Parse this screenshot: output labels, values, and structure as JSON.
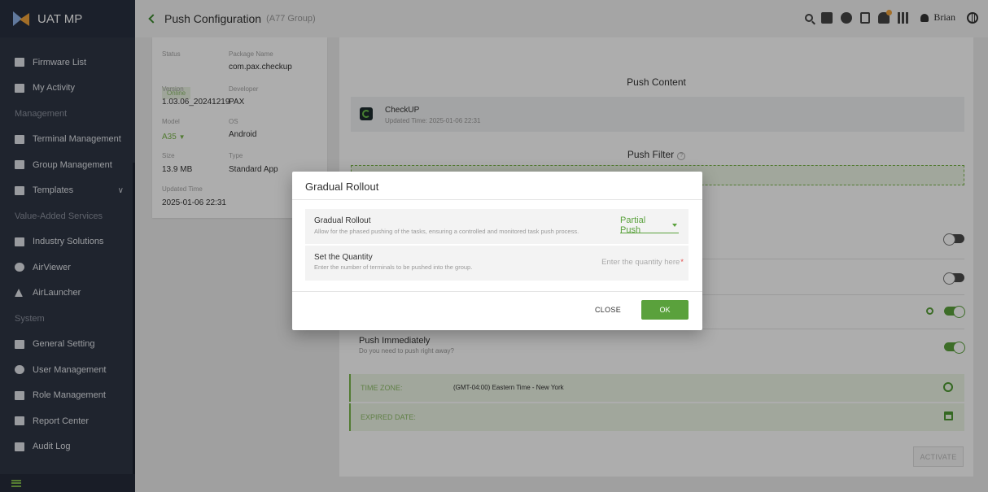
{
  "app": {
    "title": "UAT MP"
  },
  "sidebar": {
    "items": [
      {
        "label": "Firmware List"
      },
      {
        "label": "My Activity"
      },
      {
        "section": "Management"
      },
      {
        "label": "Terminal Management"
      },
      {
        "label": "Group Management"
      },
      {
        "label": "Templates"
      },
      {
        "section": "Value-Added Services"
      },
      {
        "label": "Industry Solutions"
      },
      {
        "label": "AirViewer"
      },
      {
        "label": "AirLauncher"
      },
      {
        "section": "System"
      },
      {
        "label": "General Setting"
      },
      {
        "label": "User Management"
      },
      {
        "label": "Role Management"
      },
      {
        "label": "Report Center"
      },
      {
        "label": "Audit Log"
      }
    ]
  },
  "header": {
    "title": "Push Configuration",
    "subtitle": "(A77 Group)",
    "user": "Brian"
  },
  "info": {
    "status_label": "Status",
    "status_value": "Online",
    "package_label": "Package Name",
    "package_value": "com.pax.checkup",
    "version_label": "Version",
    "version_value": "1.03.06_20241219",
    "developer_label": "Developer",
    "developer_value": "PAX",
    "model_label": "Model",
    "model_value": "A35",
    "os_label": "OS",
    "os_value": "Android",
    "size_label": "Size",
    "size_value": "13.9 MB",
    "type_label": "Type",
    "type_value": "Standard App",
    "updated_label": "Updated Time",
    "updated_value": "2025-01-06 22:31"
  },
  "main": {
    "push_content_title": "Push Content",
    "app_name": "CheckUP",
    "app_updated": "Updated Time: 2025-01-06 22:31",
    "push_filter_title": "Push Filter",
    "push_immediately_title": "Push Immediately",
    "push_immediately_sub": "Do you need to push right away?",
    "time_zone_label": "TIME ZONE:",
    "time_zone_value": "(GMT-04:00) Eastern Time - New York",
    "expired_label": "EXPIRED DATE:",
    "activate_label": "ACTIVATE"
  },
  "modal": {
    "title": "Gradual Rollout",
    "rollout_title": "Gradual Rollout",
    "rollout_desc": "Allow for the phased pushing of the tasks, ensuring a controlled and monitored task push process.",
    "rollout_value": "Partial Push",
    "quantity_title": "Set the Quantity",
    "quantity_desc": "Enter the number of terminals to be pushed into the group.",
    "quantity_placeholder": "Enter the quantity here",
    "close_label": "CLOSE",
    "ok_label": "OK"
  },
  "colors": {
    "accent": "#5aa13c",
    "sidebar_bg": "#2f3645"
  }
}
